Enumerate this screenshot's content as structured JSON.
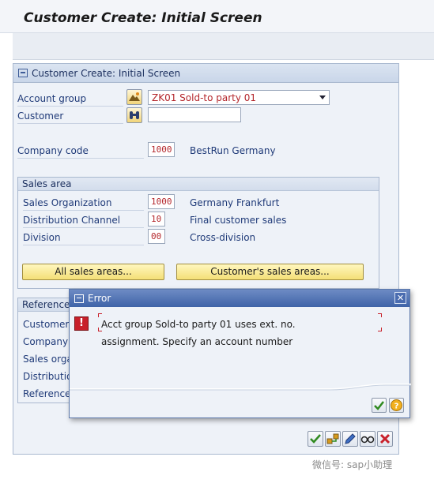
{
  "window": {
    "title": "Customer Create: Initial Screen"
  },
  "panel": {
    "title": "Customer Create: Initial Screen",
    "account_group_label": "Account group",
    "account_group_value": "ZK01 Sold-to party 01",
    "customer_label": "Customer",
    "customer_value": "",
    "company_code_label": "Company code",
    "company_code_value": "1000",
    "company_code_desc": "BestRun Germany"
  },
  "sales_area": {
    "title": "Sales area",
    "rows": [
      {
        "label": "Sales Organization",
        "value": "1000",
        "desc": "Germany Frankfurt"
      },
      {
        "label": "Distribution Channel",
        "value": "10",
        "desc": "Final customer sales"
      },
      {
        "label": "Division",
        "value": "00",
        "desc": "Cross-division"
      }
    ],
    "all_sales_areas_button": "All sales areas...",
    "customer_sales_areas_button": "Customer's sales areas..."
  },
  "reference": {
    "title": "Reference",
    "labels": [
      "Customer",
      "Company c",
      "Sales orga",
      "Distributio",
      "Reference"
    ]
  },
  "dialog": {
    "title": "Error",
    "close_glyph": "✕",
    "message_line1": "Acct group Sold-to party 01 uses ext. no.",
    "message_line2": "assignment. Specify an account number",
    "error_glyph": "!"
  },
  "watermark": "微信号: sap小助理",
  "colors": {
    "accent": "#3f63a8",
    "error": "#c8202a",
    "button_yellow": "#f4df76",
    "label_blue": "#1f3a78"
  },
  "icons": {
    "account_group_help": "mountain-icon",
    "customer_search": "binoculars-icon",
    "dialog_continue": "checkmark-icon",
    "dialog_help": "help-icon",
    "bottom_toolbar": [
      "checkmark-icon",
      "hierarchy-icon",
      "edit-icon",
      "glasses-icon",
      "cancel-icon"
    ]
  }
}
